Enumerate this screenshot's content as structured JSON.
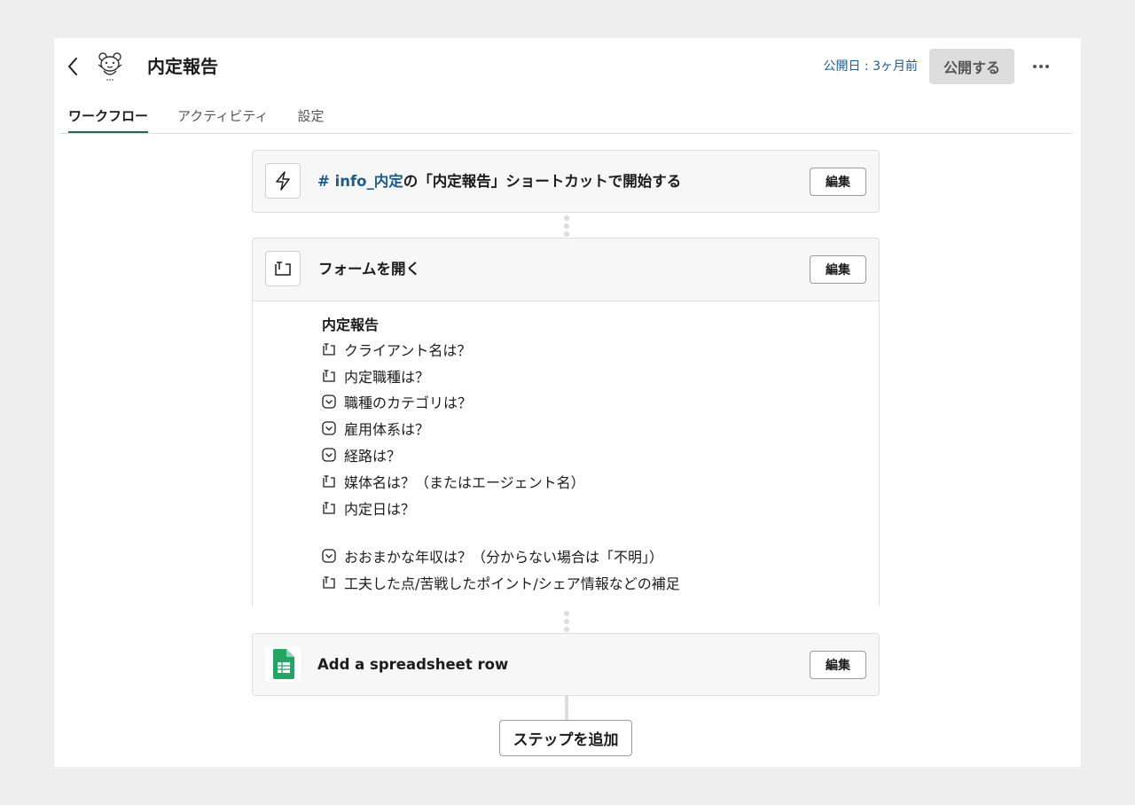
{
  "header": {
    "title": "内定報告",
    "published": "公開日 : 3ヶ月前",
    "publish_button": "公開する"
  },
  "tabs": [
    {
      "label": "ワークフロー",
      "active": true
    },
    {
      "label": "アクティビティ",
      "active": false
    },
    {
      "label": "設定",
      "active": false
    }
  ],
  "steps": {
    "trigger": {
      "channel": "# info_内定",
      "text": "の「内定報告」ショートカットで開始する",
      "edit": "編集",
      "icon": "lightning-icon"
    },
    "form": {
      "title": "フォームを開く",
      "edit": "編集",
      "icon": "text-field-icon",
      "form_name": "内定報告",
      "fields": [
        {
          "type": "text",
          "label": "クライアント名は？"
        },
        {
          "type": "text",
          "label": "内定職種は？"
        },
        {
          "type": "select",
          "label": "職種のカテゴリは？"
        },
        {
          "type": "select",
          "label": "雇用体系は？"
        },
        {
          "type": "select",
          "label": "経路は？"
        },
        {
          "type": "text",
          "label": "媒体名は？（またはエージェント名）"
        },
        {
          "type": "text",
          "label": "内定日は？"
        },
        {
          "type": "select",
          "label": "おおまかな年収は？（分からない場合は「不明」）"
        },
        {
          "type": "text",
          "label": "工夫した点/苦戦したポイント/シェア情報などの補足"
        }
      ]
    },
    "spreadsheet": {
      "title": "Add a spreadsheet row",
      "edit": "編集",
      "icon": "google-sheets-icon"
    }
  },
  "add_step_button": "ステップを追加",
  "colors": {
    "link": "#1d5d8e",
    "active_tab": "#1e6b52",
    "sheets_green": "#23a566"
  }
}
